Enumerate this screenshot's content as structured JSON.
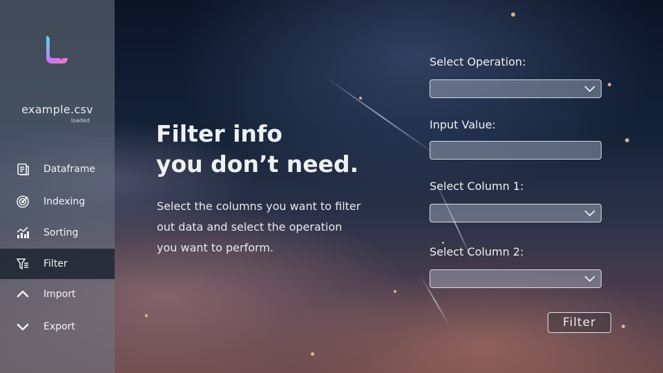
{
  "file": {
    "name": "example.csv",
    "status": "loaded"
  },
  "sidebar": {
    "items": [
      {
        "label": "Dataframe",
        "icon": "document-list-icon"
      },
      {
        "label": "Indexing",
        "icon": "target-icon"
      },
      {
        "label": "Sorting",
        "icon": "bar-chart-trend-icon"
      },
      {
        "label": "Filter",
        "icon": "filter-funnel-icon",
        "active": true
      },
      {
        "label": "Import",
        "icon": "chevron-up-icon"
      },
      {
        "label": "Export",
        "icon": "chevron-down-icon"
      }
    ]
  },
  "main": {
    "headline_line1": "Filter info",
    "headline_line2": "you don’t need.",
    "description": "Select the columns you want to filter out data and select the operation you want to perform."
  },
  "form": {
    "operation_label": "Select Operation:",
    "operation_value": "",
    "input_label": "Input Value:",
    "input_value": "",
    "column1_label": "Select Column 1:",
    "column1_value": "",
    "column2_label": "Select Column 2:",
    "column2_value": "",
    "filter_button": "Filter"
  },
  "colors": {
    "sidebar_bg": "#6e7684",
    "active_item_bg": "#141c28",
    "logo_gradient": [
      "#5fd0f0",
      "#c07be8",
      "#f07ac0"
    ]
  }
}
